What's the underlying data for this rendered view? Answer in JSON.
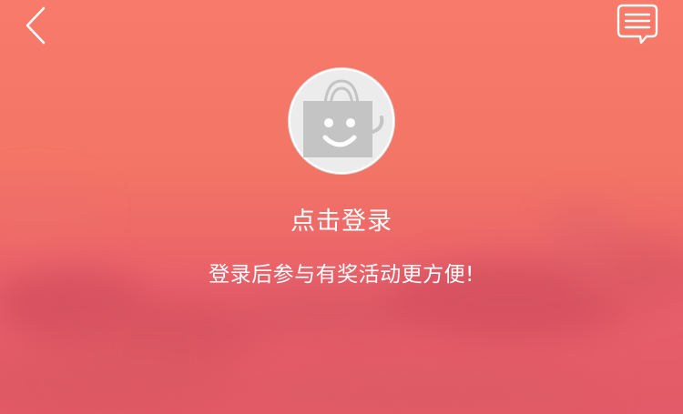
{
  "header": {
    "back_icon": "chevron-left-icon",
    "message_icon": "message-bubble-icon"
  },
  "profile": {
    "avatar_icon": "shopping-bag-smile-icon",
    "login_label": "点击登录",
    "login_hint": "登录后参与有奖活动更方便!"
  },
  "colors": {
    "background_top": "#f87a6a",
    "background_bottom": "#e35a68",
    "avatar_bg": "#ececec",
    "avatar_glyph": "#c4c4c4",
    "text": "#ffffff"
  }
}
